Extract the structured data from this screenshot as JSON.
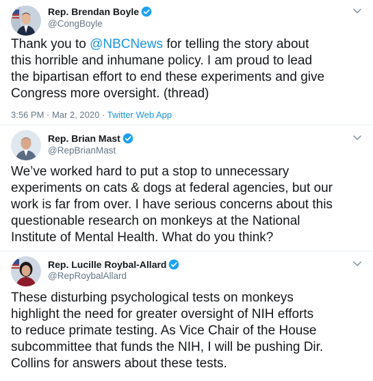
{
  "colors": {
    "accent": "#1b95e0",
    "muted": "#657786",
    "text": "#14171a",
    "verified": "#1da1f2"
  },
  "tweets": [
    {
      "name": "Rep. Brendan Boyle",
      "handle": "@CongBoyle",
      "verified": true,
      "avatar_icon": "avatar-photo",
      "text_before": "Thank you to ",
      "mention": "@NBCNews",
      "text_after_first": " for telling the story about",
      "lines_rest": [
        "this horrible and inhumane policy.  I am proud to lead",
        "the bipartisan effort to end these experiments and give",
        "Congress more oversight.  (thread)"
      ],
      "time": "3:56 PM · Mar 2, 2020",
      "separator": " · ",
      "app": "Twitter Web App"
    },
    {
      "name": "Rep. Brian Mast",
      "handle": "@RepBrianMast",
      "verified": true,
      "avatar_icon": "avatar-photo",
      "lines": [
        "We’ve worked hard to put a stop to unnecessary",
        "experiments on cats & dogs at federal agencies, but our",
        "work is far from over. I have serious concerns about this",
        "questionable research on monkeys at the National",
        "Institute of Mental Health. What do you think?"
      ]
    },
    {
      "name": "Rep. Lucille Roybal-Allard",
      "handle": "@RepRoybalAllard",
      "verified": true,
      "avatar_icon": "avatar-photo",
      "lines": [
        "These disturbing psychological tests on monkeys",
        "highlight the need for greater oversight of NIH efforts",
        "to reduce primate testing. As Vice Chair of the House",
        "subcommittee that funds the NIH, I will be pushing Dir.",
        "Collins for answers about these tests."
      ]
    }
  ]
}
